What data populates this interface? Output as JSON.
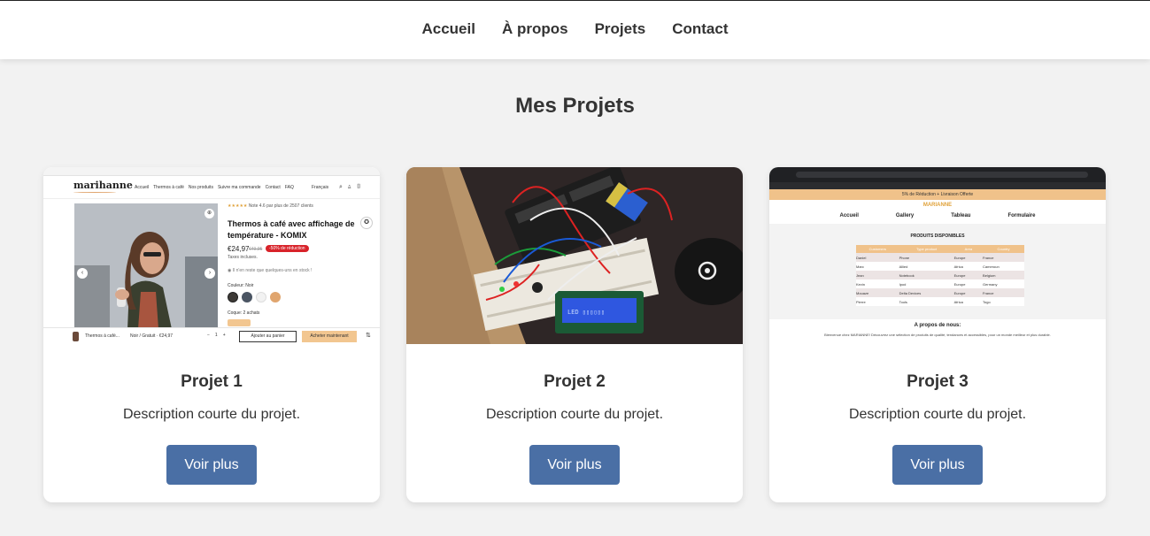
{
  "nav": {
    "items": [
      "Accueil",
      "À propos",
      "Projets",
      "Contact"
    ]
  },
  "section": {
    "title": "Mes Projets"
  },
  "projects": [
    {
      "title": "Projet 1",
      "description": "Description courte du projet.",
      "button": "Voir plus",
      "thumb": {
        "brand": "marihanne",
        "menu": [
          "Accueil",
          "Thermos à café",
          "Nos produits",
          "Suivre ma commande",
          "Contact",
          "FAQ"
        ],
        "lang": "Français",
        "rating": "Note 4.6 par plus de 2507 clients",
        "product_title": "Thermos à café avec affichage de température - KOMIX",
        "price": "€24,97",
        "old_price": "€49,95",
        "discount": "-50% de réduction",
        "tax": "Taxes incluses.",
        "stock": "Il n'en reste que quelques-uns en stock !",
        "color_label": "Couleur: Noir",
        "colors": [
          "#3d3a36",
          "#4b5563",
          "#f2f2f2",
          "#e0a56e"
        ],
        "offer_label": "Coque: 2 achats",
        "sticky_item": "Thermos à café...",
        "sticky_variant": "Noir / Gratuit · €24,97",
        "sticky_qty": "1",
        "add_to_cart": "Ajouter au panier",
        "buy_now": "Acheter maintenant"
      }
    },
    {
      "title": "Projet 2",
      "description": "Description courte du projet.",
      "button": "Voir plus",
      "thumb": {
        "lcd_text": "LED ▯▯▯▯▯▯"
      }
    },
    {
      "title": "Projet 3",
      "description": "Description courte du projet.",
      "button": "Voir plus",
      "thumb": {
        "banner": "5% de Réduction + Livraison Offerte",
        "brand": "MARIANNE",
        "menu": [
          "Accueil",
          "Gallery",
          "Tableau",
          "Formulaire"
        ],
        "table_title": "PRODUITS DISPONIBLES",
        "table_headers": [
          "Customers",
          "Type product",
          "Area",
          "Country"
        ],
        "table_rows": [
          [
            "Daniel",
            "Phone",
            "Europe",
            "France"
          ],
          [
            "Marc",
            "Allied",
            "Africa",
            "Cameroun"
          ],
          [
            "Jean",
            "Notebook",
            "Europe",
            "Belgium"
          ],
          [
            "Kevin",
            "Ipod",
            "Europe",
            "Germany"
          ],
          [
            "Mouaze",
            "Delta Devices",
            "Europe",
            "France"
          ],
          [
            "Pierre",
            "Tools",
            "Africa",
            "Togo"
          ]
        ],
        "about_title": "A propos de nous:",
        "about_text": "Bienvenue chez MARIANNE! Découvrez une sélection de produits de qualité, tendances et accessibles, pour un monde meilleur et plus durable."
      }
    }
  ]
}
